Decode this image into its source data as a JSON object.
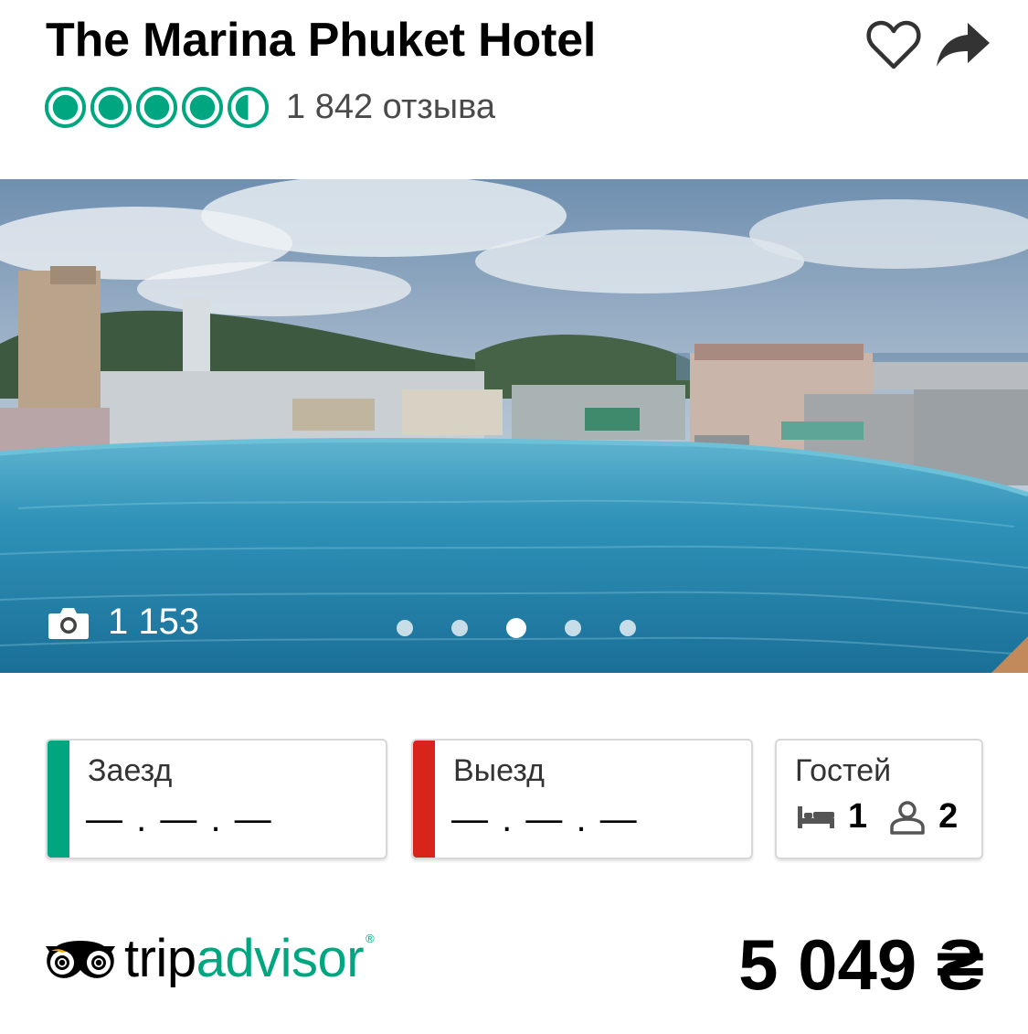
{
  "header": {
    "title": "The Marina Phuket Hotel",
    "favorite_icon": "heart-outline-icon",
    "share_icon": "share-arrow-icon"
  },
  "rating": {
    "value": 4.5,
    "max": 5,
    "bubble_color": "#00a680",
    "reviews_label": "1 842 отзыва"
  },
  "gallery": {
    "photo_count": "1 153",
    "camera_icon": "camera-icon",
    "dot_count": 5,
    "active_dot": 3
  },
  "booking": {
    "checkin": {
      "label": "Заезд",
      "value": "— . — . —",
      "accent": "#00a680"
    },
    "checkout": {
      "label": "Выезд",
      "value": "— . — . —",
      "accent": "#d9241c"
    },
    "guests": {
      "label": "Гостей",
      "rooms": "1",
      "people": "2",
      "room_icon": "bed-icon",
      "people_icon": "person-icon"
    }
  },
  "footer": {
    "brand_trip": "trip",
    "brand_advisor": "advisor",
    "brand_reg": "®",
    "price": "5 049 ₴"
  }
}
